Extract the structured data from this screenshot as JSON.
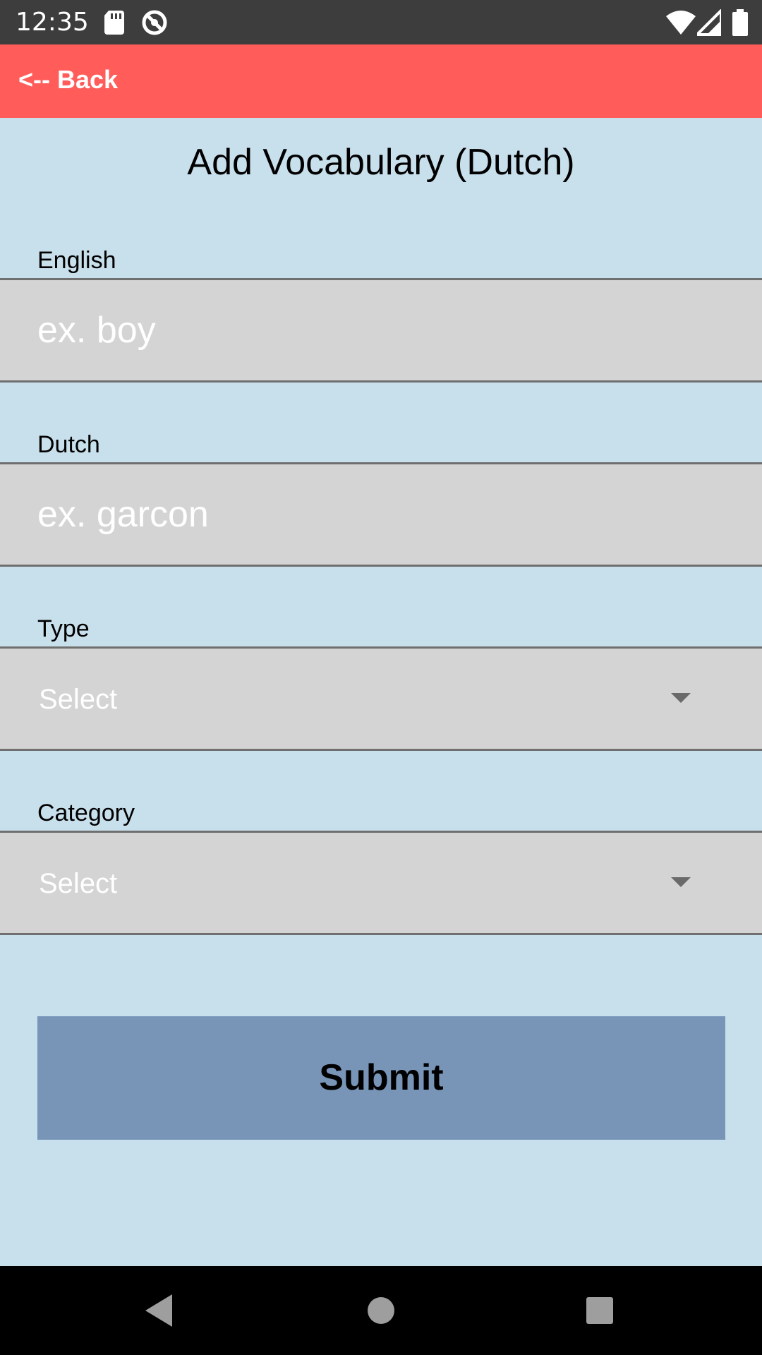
{
  "status_bar": {
    "time": "12:35",
    "icons": [
      "sd-card-icon",
      "do-not-disturb-icon",
      "wifi-icon",
      "signal-icon",
      "battery-icon"
    ]
  },
  "header": {
    "back_label": "<-- Back",
    "color": "#ff5c5a"
  },
  "page": {
    "title": "Add Vocabulary (Dutch)",
    "background": "#c8dfec"
  },
  "fields": {
    "english": {
      "label": "English",
      "placeholder": "ex. boy",
      "value": ""
    },
    "dutch": {
      "label": "Dutch",
      "placeholder": "ex. garcon",
      "value": ""
    },
    "type": {
      "label": "Type",
      "selected": "Select"
    },
    "category": {
      "label": "Category",
      "selected": "Select"
    }
  },
  "submit": {
    "label": "Submit",
    "color": "#7895b8"
  },
  "nav_bar": {
    "buttons": [
      "back-triangle-icon",
      "home-circle-icon",
      "recents-square-icon"
    ]
  }
}
